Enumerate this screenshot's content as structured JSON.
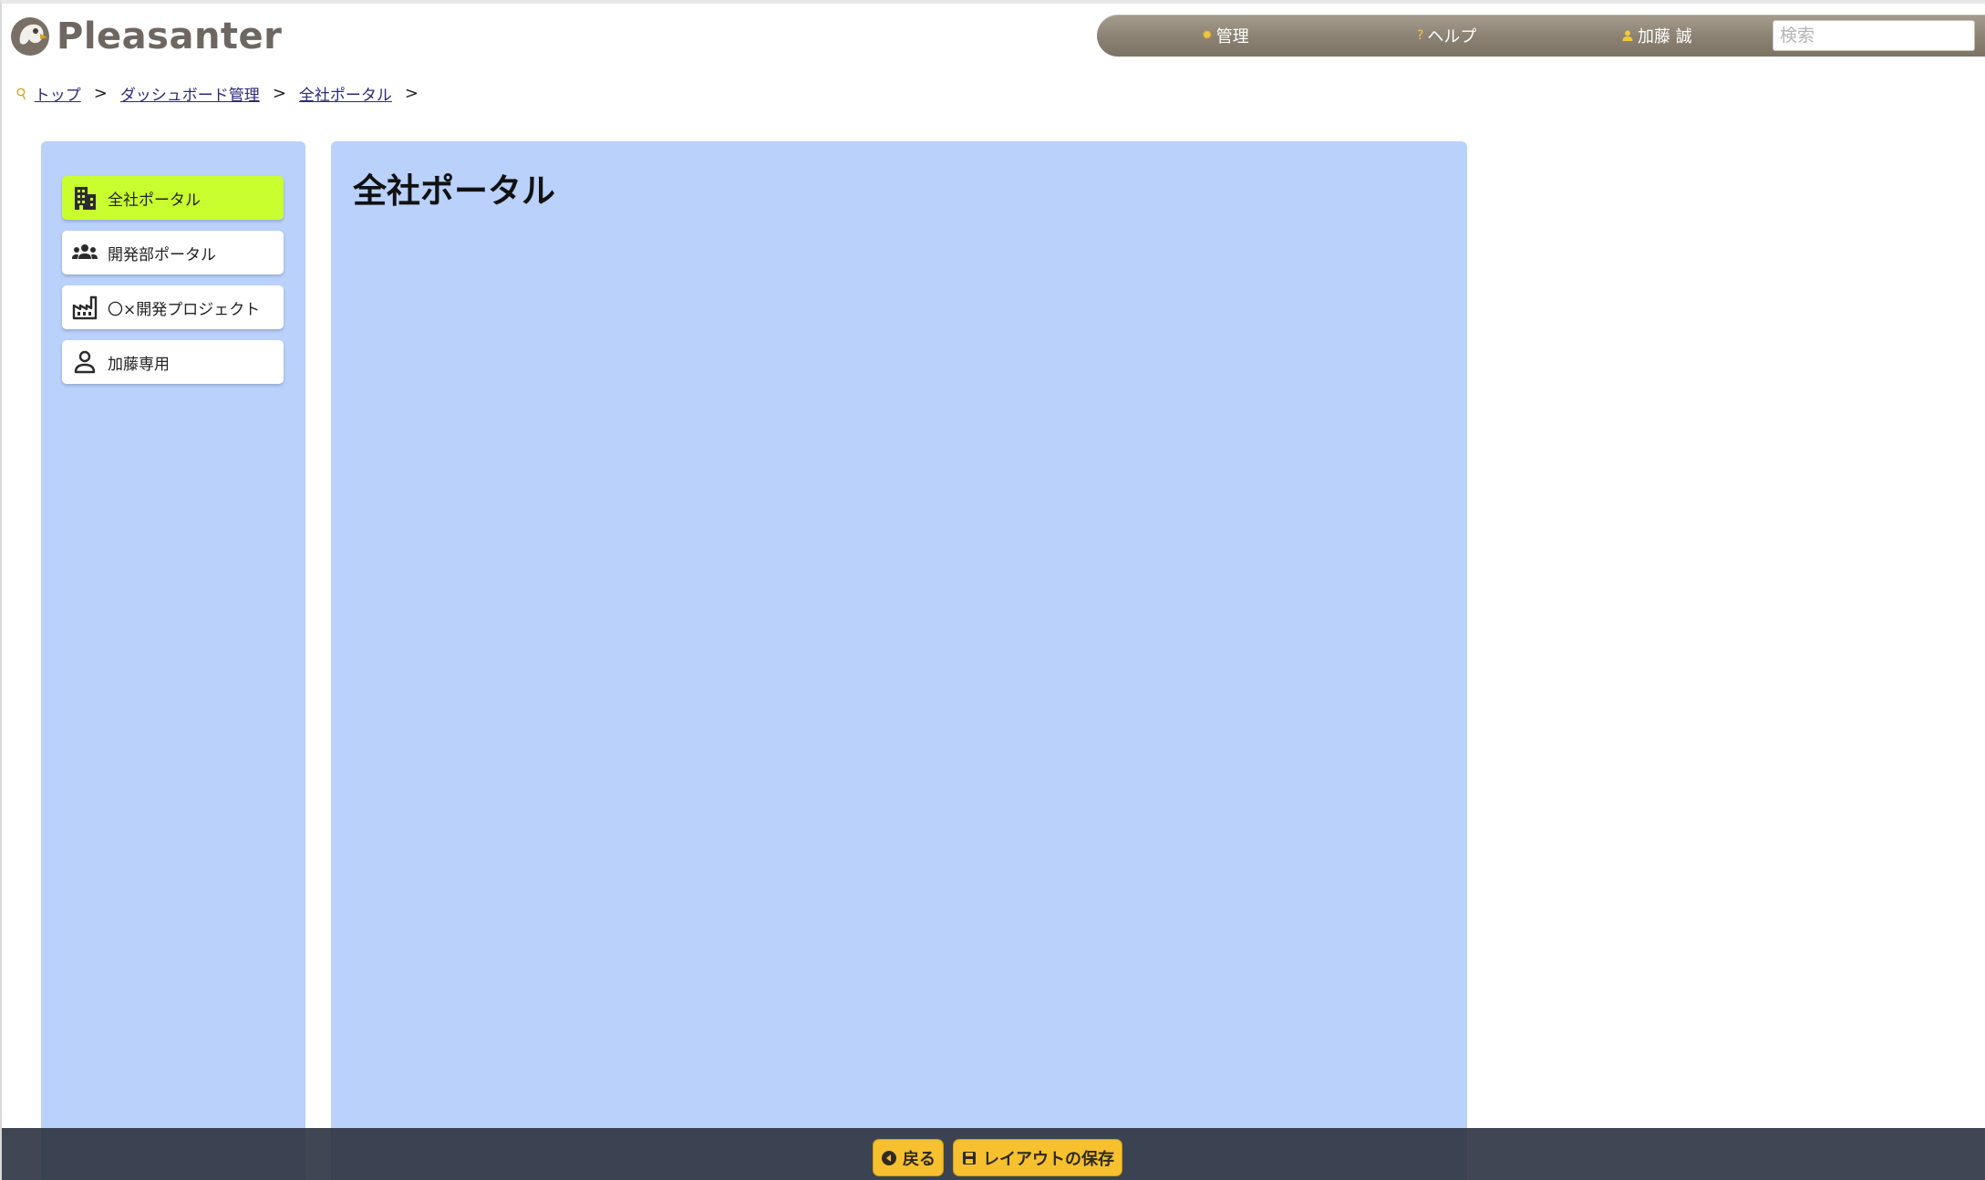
{
  "app": {
    "logo_text": "Pleasanter"
  },
  "topbar": {
    "admin_label": "管理",
    "admin_icon": "gear-icon",
    "help_label": "ヘルプ",
    "help_icon": "question-icon",
    "user_label": "加藤 誠",
    "user_icon": "user-icon",
    "search_placeholder": "検索"
  },
  "breadcrumb": {
    "icon": "pin-icon",
    "items": [
      {
        "label": "トップ"
      },
      {
        "label": "ダッシュボード管理"
      },
      {
        "label": "全社ポータル"
      }
    ],
    "separator": ">"
  },
  "sidebar": {
    "items": [
      {
        "label": "全社ポータル",
        "icon": "building-icon",
        "active": true
      },
      {
        "label": "開発部ポータル",
        "icon": "group-icon",
        "active": false
      },
      {
        "label": "〇×開発プロジェクト",
        "icon": "factory-icon",
        "active": false
      },
      {
        "label": "加藤専用",
        "icon": "person-icon",
        "active": false
      }
    ]
  },
  "main": {
    "title": "全社ポータル"
  },
  "bottombar": {
    "back_label": "戻る",
    "back_icon": "back-arrow-icon",
    "save_label": "レイアウトの保存",
    "save_icon": "save-icon"
  },
  "colors": {
    "panel_bg": "#b9d1fb",
    "active_item": "#c9ff2f",
    "topbar": "#8a8172",
    "button": "#f6c02e",
    "bottombar": "#3a4150"
  }
}
